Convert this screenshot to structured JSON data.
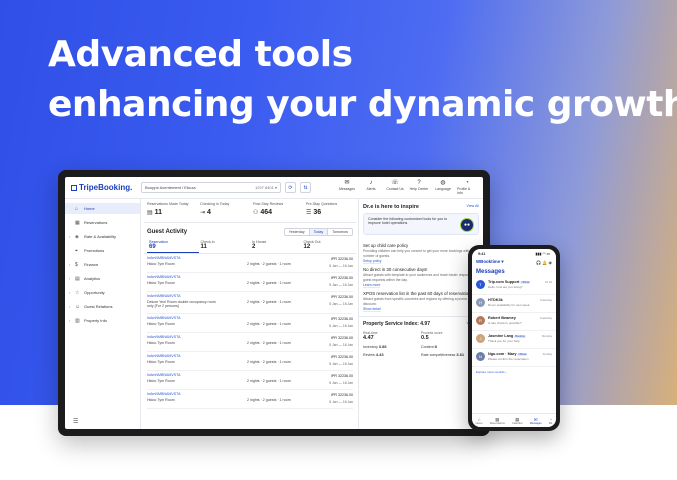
{
  "headline": [
    "Advanced tools",
    "enhancing your dynamic growth"
  ],
  "colors": {
    "brand": "#1a3fb8",
    "hero_start": "#2f4fe6",
    "hero_end": "#d8b07a",
    "accent_green": "#9fd44d"
  },
  "laptop": {
    "logo": "TripeBooking.",
    "property_select": {
      "value": "Booppe Aventement / Ebuza",
      "id": "1297 8401"
    },
    "nav": [
      {
        "label": "Messages",
        "icon": "message-icon"
      },
      {
        "label": "Alerts",
        "icon": "bell-icon"
      },
      {
        "label": "Contact Us",
        "icon": "phone-icon"
      },
      {
        "label": "Help Center",
        "icon": "help-icon"
      },
      {
        "label": "Language",
        "icon": "globe-icon"
      },
      {
        "label": "Profile & Info",
        "icon": "user-icon"
      }
    ],
    "sidebar": [
      {
        "label": "Home",
        "icon": "home-icon",
        "active": true,
        "chev": ""
      },
      {
        "label": "Reservations",
        "icon": "calendar-icon",
        "active": false,
        "chev": ""
      },
      {
        "label": "Rate & Availability",
        "icon": "rate-icon",
        "active": false,
        "chev": "›"
      },
      {
        "label": "Promotions",
        "icon": "tag-icon",
        "active": false,
        "chev": ""
      },
      {
        "label": "Finance",
        "icon": "finance-icon",
        "active": false,
        "chev": "›"
      },
      {
        "label": "Analytics",
        "icon": "chart-icon",
        "active": false,
        "chev": "›"
      },
      {
        "label": "Opportunity",
        "icon": "star-icon",
        "active": false,
        "chev": "›"
      },
      {
        "label": "Guest Relations",
        "icon": "guest-icon",
        "active": false,
        "chev": "›"
      },
      {
        "label": "Property Info",
        "icon": "building-icon",
        "active": false,
        "chev": "›"
      }
    ],
    "stats": [
      {
        "label": "Reservations Made Today",
        "value": "11",
        "icon": "doc-icon"
      },
      {
        "label": "Checking in Today",
        "value": "4",
        "icon": "door-icon"
      },
      {
        "label": "Post-Stay Reviews",
        "value": "464",
        "icon": "people-icon"
      },
      {
        "label": "Pre-Stay Questions",
        "value": "36",
        "icon": "question-icon"
      }
    ],
    "guest_activity": {
      "title": "Guest Activity",
      "day_tabs": [
        "Yesterday",
        "Today",
        "Tomorrow"
      ],
      "subtabs": [
        {
          "label": "Reservation",
          "num": "69"
        },
        {
          "label": "Check-in",
          "num": "11"
        },
        {
          "label": "In House",
          "num": "2"
        },
        {
          "label": "Check Out",
          "num": "12"
        }
      ],
      "rows": [
        {
          "code": "InAmNMBNAMVSTA",
          "room": "Hidoo Tym Room",
          "stay": "2 nights · 2 guests · 1 room",
          "price": "IPR 32236.00",
          "date": "5 Jan — 16 Jan"
        },
        {
          "code": "InAmNMBNAMVSTA",
          "room": "Hidoo Tym Room",
          "stay": "2 nights · 2 guests · 1 room",
          "price": "IPR 32236.00",
          "date": "5 Jan — 16 Jan"
        },
        {
          "code": "InAmNMBNAMVSTA",
          "room": "Deluxe Yeol Room double occupancy room",
          "room2": "only [For 2 persons]",
          "stay": "2 nights · 2 guests · 1 room",
          "price": "IPR 32236.00",
          "date": "5 Jan — 16 Jan"
        },
        {
          "code": "InAmNMBNAMVSTA",
          "room": "Hidoo Tym Room",
          "stay": "2 nights · 2 guests · 1 room",
          "price": "IPR 32236.00",
          "date": "5 Jan — 16 Jan"
        },
        {
          "code": "InAmNMBNAMVSTA",
          "room": "Hidoo Tym Room",
          "stay": "2 nights · 2 guests · 1 room",
          "price": "IPR 32236.00",
          "date": "5 Jan — 16 Jan"
        },
        {
          "code": "InAmNMBNAMVSTA",
          "room": "Hidoo Tym Room",
          "stay": "2 nights · 2 guests · 1 room",
          "price": "IPR 32236.00",
          "date": "5 Jan — 16 Jan"
        },
        {
          "code": "InAmNMBNAMVSTA",
          "room": "Hidoo Tym Room",
          "stay": "2 nights · 2 guests · 1 room",
          "price": "IPR 32236.00",
          "date": "5 Jan — 16 Jan"
        },
        {
          "code": "InAmNMBNAMVSTA",
          "room": "Hidoo Tym Room",
          "stay": "2 nights · 2 guests · 1 room",
          "price": "IPR 32236.00",
          "date": "5 Jan — 16 Jan"
        }
      ]
    },
    "inspire": {
      "title": "Dr.e is here to inspire",
      "view_all": "View All",
      "card_text": "Consider the following customized tools for you to improve hotel operations",
      "tips": [
        {
          "title": "Set up child care policy",
          "text": "Providing children can help you convert to get your more bookings with the number of guests.",
          "link": "Setup policy"
        },
        {
          "title": "No direct in 30 consecutive days!",
          "text": "Attract guests with template to your audiences and reach faster response to guest requests within the day.",
          "link": "Learn more"
        },
        {
          "title": "XPOS reservation list in the past 60 days of reservation",
          "text": "Attract guests from specific countries and regions by offering a promo of your discount.",
          "link": "Show detail"
        }
      ]
    },
    "psi": {
      "title": "Property Service Index: 4.97",
      "view": "View All",
      "items": [
        {
          "k": "Real-time",
          "v": "4.47"
        },
        {
          "k": "Process score",
          "v": "0.5"
        }
      ],
      "pairs": [
        {
          "k": "Inventory",
          "v": "3.86"
        },
        {
          "k": "Content",
          "v": "8"
        },
        {
          "k": "Review",
          "v": "4.43"
        },
        {
          "k": "Rate competitiveness",
          "v": "3.61"
        }
      ]
    }
  },
  "phone": {
    "time": "9:41",
    "signal": "▮▮▮ ◠ ▭",
    "property": "WBooktime ▾",
    "title": "Messages",
    "messages": [
      {
        "name": "Trip.com Support",
        "badge": "Official",
        "sub": "Hello, how are you doing?",
        "time": "10:22",
        "color": "#2b57d6",
        "initial": "T"
      },
      {
        "name": "HTDK3k",
        "badge": "",
        "sub": "Room availability for next week",
        "time": "Yesterday",
        "color": "#8a9bb8",
        "initial": "H"
      },
      {
        "name": "Robert Beamey",
        "badge": "",
        "sub": "Is late check-in possible?",
        "time": "Yesterday",
        "color": "#b07a5a",
        "initial": "R"
      },
      {
        "name": "Jasmine Lang",
        "badge": "Booking",
        "sub": "Thank you for your help",
        "time": "Monday",
        "color": "#c9a37a",
        "initial": "J"
      },
      {
        "name": "Ngu.com · Mary",
        "badge": "Official",
        "sub": "Please confirm the reservation",
        "time": "Sunday",
        "color": "#6d7fa8",
        "initial": "N"
      }
    ],
    "more": "Explore more records ›",
    "tabs": [
      {
        "label": "Home",
        "icon": "home-icon",
        "sel": false
      },
      {
        "label": "Reservations",
        "icon": "calendar-icon",
        "sel": false
      },
      {
        "label": "Calendar",
        "icon": "grid-icon",
        "sel": false
      },
      {
        "label": "Messages",
        "icon": "message-icon",
        "sel": true
      },
      {
        "label": "Me",
        "icon": "user-icon",
        "sel": false
      }
    ]
  }
}
